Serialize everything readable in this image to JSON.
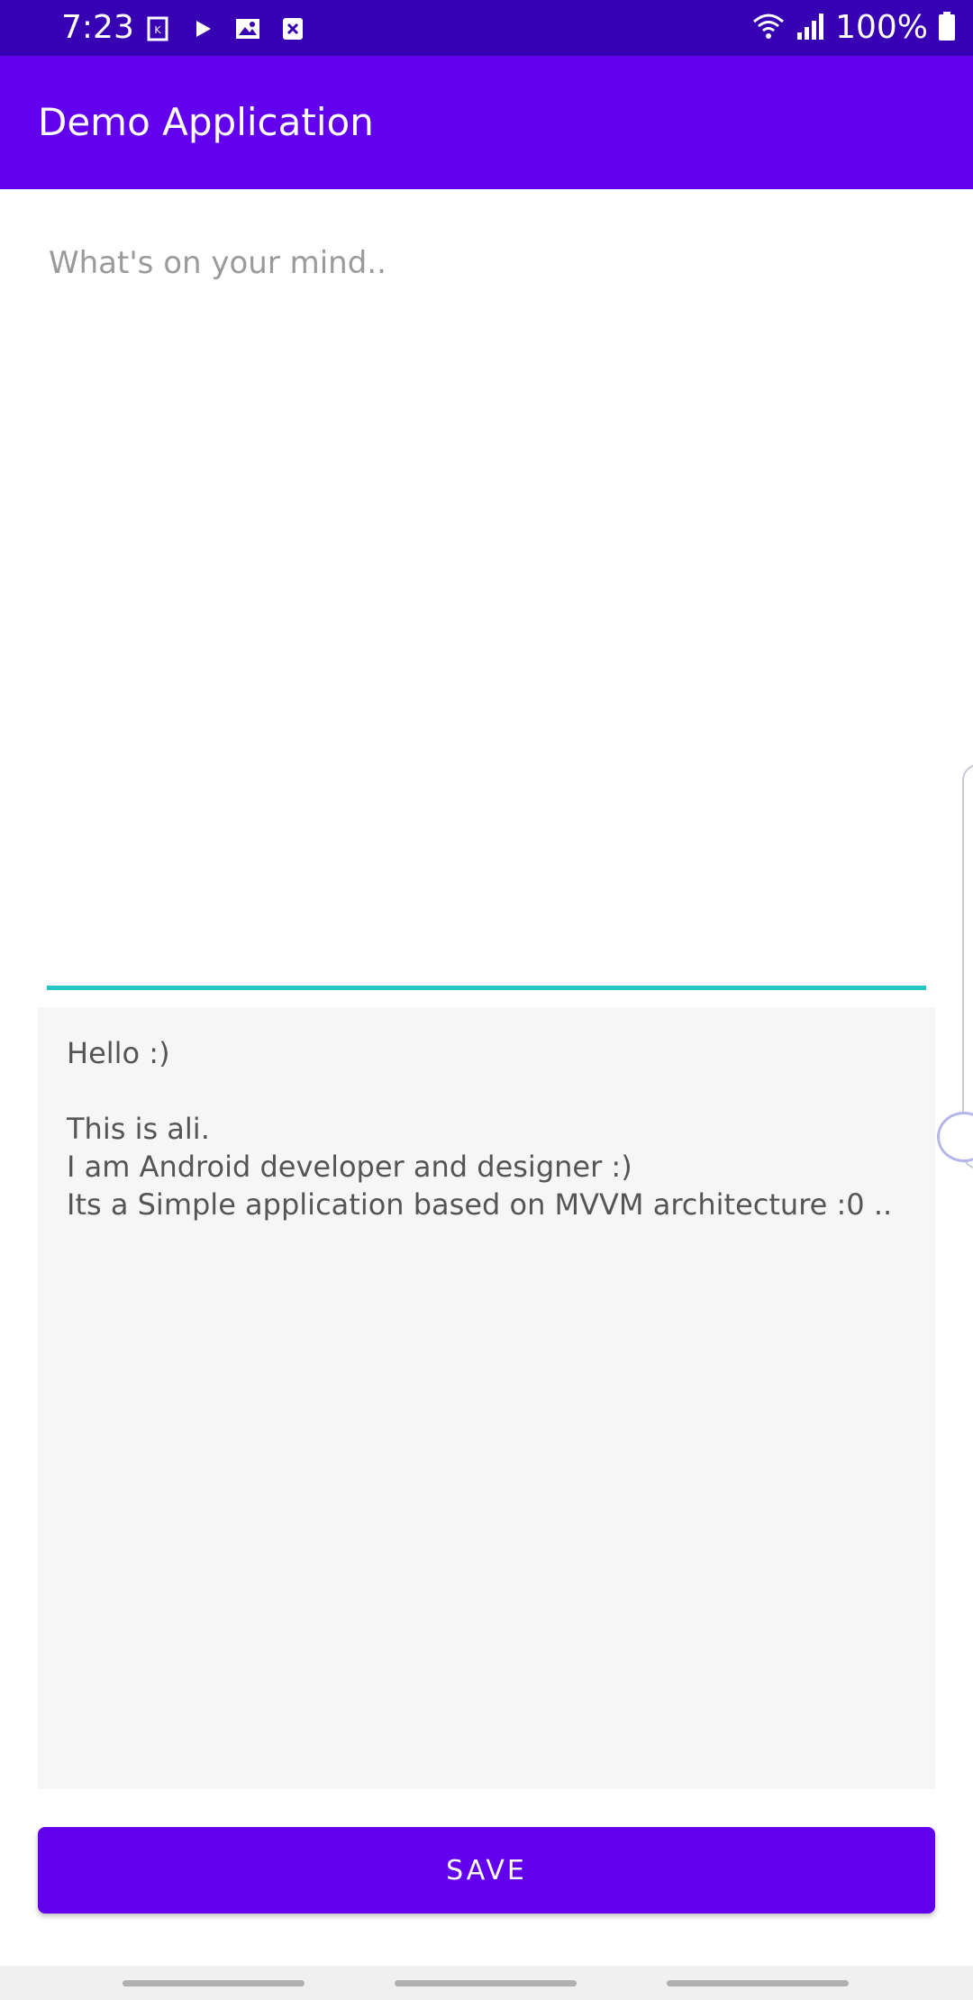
{
  "status_bar": {
    "time": "7:23",
    "left_icons": [
      "k-icon",
      "play-icon",
      "image-icon",
      "block-icon"
    ],
    "battery_text": "100%",
    "colors": {
      "background": "#3700b3"
    }
  },
  "app_bar": {
    "title": "Demo Application",
    "colors": {
      "background": "#6200ee"
    }
  },
  "editor": {
    "placeholder": "What's on your mind..",
    "value": "",
    "underline_color": "#26c6c4"
  },
  "notes": {
    "text": "Hello :)\n\nThis is ali.\nI am Android developer and designer :)\nIts a Simple application based on MVVM architecture :0 .."
  },
  "actions": {
    "save_label": "SAVE",
    "accent": "#6200ee"
  }
}
